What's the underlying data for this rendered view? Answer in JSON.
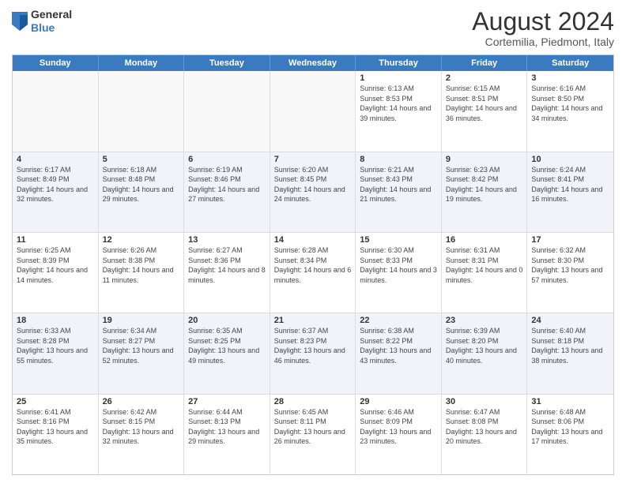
{
  "header": {
    "logo_general": "General",
    "logo_blue": "Blue",
    "title": "August 2024",
    "subtitle": "Cortemilia, Piedmont, Italy"
  },
  "calendar": {
    "days": [
      "Sunday",
      "Monday",
      "Tuesday",
      "Wednesday",
      "Thursday",
      "Friday",
      "Saturday"
    ],
    "rows": [
      [
        {
          "date": "",
          "info": ""
        },
        {
          "date": "",
          "info": ""
        },
        {
          "date": "",
          "info": ""
        },
        {
          "date": "",
          "info": ""
        },
        {
          "date": "1",
          "info": "Sunrise: 6:13 AM\nSunset: 8:53 PM\nDaylight: 14 hours and 39 minutes."
        },
        {
          "date": "2",
          "info": "Sunrise: 6:15 AM\nSunset: 8:51 PM\nDaylight: 14 hours and 36 minutes."
        },
        {
          "date": "3",
          "info": "Sunrise: 6:16 AM\nSunset: 8:50 PM\nDaylight: 14 hours and 34 minutes."
        }
      ],
      [
        {
          "date": "4",
          "info": "Sunrise: 6:17 AM\nSunset: 8:49 PM\nDaylight: 14 hours and 32 minutes."
        },
        {
          "date": "5",
          "info": "Sunrise: 6:18 AM\nSunset: 8:48 PM\nDaylight: 14 hours and 29 minutes."
        },
        {
          "date": "6",
          "info": "Sunrise: 6:19 AM\nSunset: 8:46 PM\nDaylight: 14 hours and 27 minutes."
        },
        {
          "date": "7",
          "info": "Sunrise: 6:20 AM\nSunset: 8:45 PM\nDaylight: 14 hours and 24 minutes."
        },
        {
          "date": "8",
          "info": "Sunrise: 6:21 AM\nSunset: 8:43 PM\nDaylight: 14 hours and 21 minutes."
        },
        {
          "date": "9",
          "info": "Sunrise: 6:23 AM\nSunset: 8:42 PM\nDaylight: 14 hours and 19 minutes."
        },
        {
          "date": "10",
          "info": "Sunrise: 6:24 AM\nSunset: 8:41 PM\nDaylight: 14 hours and 16 minutes."
        }
      ],
      [
        {
          "date": "11",
          "info": "Sunrise: 6:25 AM\nSunset: 8:39 PM\nDaylight: 14 hours and 14 minutes."
        },
        {
          "date": "12",
          "info": "Sunrise: 6:26 AM\nSunset: 8:38 PM\nDaylight: 14 hours and 11 minutes."
        },
        {
          "date": "13",
          "info": "Sunrise: 6:27 AM\nSunset: 8:36 PM\nDaylight: 14 hours and 8 minutes."
        },
        {
          "date": "14",
          "info": "Sunrise: 6:28 AM\nSunset: 8:34 PM\nDaylight: 14 hours and 6 minutes."
        },
        {
          "date": "15",
          "info": "Sunrise: 6:30 AM\nSunset: 8:33 PM\nDaylight: 14 hours and 3 minutes."
        },
        {
          "date": "16",
          "info": "Sunrise: 6:31 AM\nSunset: 8:31 PM\nDaylight: 14 hours and 0 minutes."
        },
        {
          "date": "17",
          "info": "Sunrise: 6:32 AM\nSunset: 8:30 PM\nDaylight: 13 hours and 57 minutes."
        }
      ],
      [
        {
          "date": "18",
          "info": "Sunrise: 6:33 AM\nSunset: 8:28 PM\nDaylight: 13 hours and 55 minutes."
        },
        {
          "date": "19",
          "info": "Sunrise: 6:34 AM\nSunset: 8:27 PM\nDaylight: 13 hours and 52 minutes."
        },
        {
          "date": "20",
          "info": "Sunrise: 6:35 AM\nSunset: 8:25 PM\nDaylight: 13 hours and 49 minutes."
        },
        {
          "date": "21",
          "info": "Sunrise: 6:37 AM\nSunset: 8:23 PM\nDaylight: 13 hours and 46 minutes."
        },
        {
          "date": "22",
          "info": "Sunrise: 6:38 AM\nSunset: 8:22 PM\nDaylight: 13 hours and 43 minutes."
        },
        {
          "date": "23",
          "info": "Sunrise: 6:39 AM\nSunset: 8:20 PM\nDaylight: 13 hours and 40 minutes."
        },
        {
          "date": "24",
          "info": "Sunrise: 6:40 AM\nSunset: 8:18 PM\nDaylight: 13 hours and 38 minutes."
        }
      ],
      [
        {
          "date": "25",
          "info": "Sunrise: 6:41 AM\nSunset: 8:16 PM\nDaylight: 13 hours and 35 minutes."
        },
        {
          "date": "26",
          "info": "Sunrise: 6:42 AM\nSunset: 8:15 PM\nDaylight: 13 hours and 32 minutes."
        },
        {
          "date": "27",
          "info": "Sunrise: 6:44 AM\nSunset: 8:13 PM\nDaylight: 13 hours and 29 minutes."
        },
        {
          "date": "28",
          "info": "Sunrise: 6:45 AM\nSunset: 8:11 PM\nDaylight: 13 hours and 26 minutes."
        },
        {
          "date": "29",
          "info": "Sunrise: 6:46 AM\nSunset: 8:09 PM\nDaylight: 13 hours and 23 minutes."
        },
        {
          "date": "30",
          "info": "Sunrise: 6:47 AM\nSunset: 8:08 PM\nDaylight: 13 hours and 20 minutes."
        },
        {
          "date": "31",
          "info": "Sunrise: 6:48 AM\nSunset: 8:06 PM\nDaylight: 13 hours and 17 minutes."
        }
      ]
    ]
  }
}
